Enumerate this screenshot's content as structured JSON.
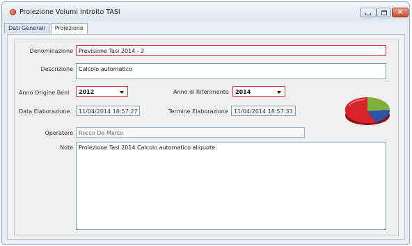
{
  "window": {
    "title": "Proiezione Volumi Introito TASI",
    "title_icon": "app-icon",
    "controls": [
      "minimize-icon",
      "maximize-icon",
      "close-icon"
    ]
  },
  "tabs": [
    {
      "label": "Dati Generali",
      "active": false
    },
    {
      "label": "Proiezione",
      "active": true
    }
  ],
  "form": {
    "denominazione": {
      "label": "Denominazione",
      "value": "Previsione Tasi 2014 - 2"
    },
    "descrizione": {
      "label": "Descrizione",
      "value": "Calcolo automatico"
    },
    "anno_origine_beni": {
      "label": "Anno Origine Beni",
      "value": "2012"
    },
    "anno_riferimento": {
      "label": "Anno di Riferimento",
      "value": "2014"
    },
    "data_elaborazione": {
      "label": "Data Elaborazione",
      "value": "11/04/2014 18:57:27"
    },
    "termine_elaborazione": {
      "label": "Termine Elaborazione",
      "value": "11/04/2014 18:57:33"
    },
    "operatore": {
      "label": "Operatore",
      "value": "Rocco De Marco"
    },
    "note": {
      "label": "Note",
      "value": "Proiezione Tasi 2014 Calcolo automatico aliquote."
    }
  },
  "pie_icon": {
    "name": "pie-chart-icon",
    "colors": [
      "#d9232b",
      "#2a56a8",
      "#7fae3a"
    ]
  },
  "colors": {
    "required_border": "#d43a3a",
    "field_border": "#7f9db9",
    "window_border": "#8ea7c5"
  }
}
